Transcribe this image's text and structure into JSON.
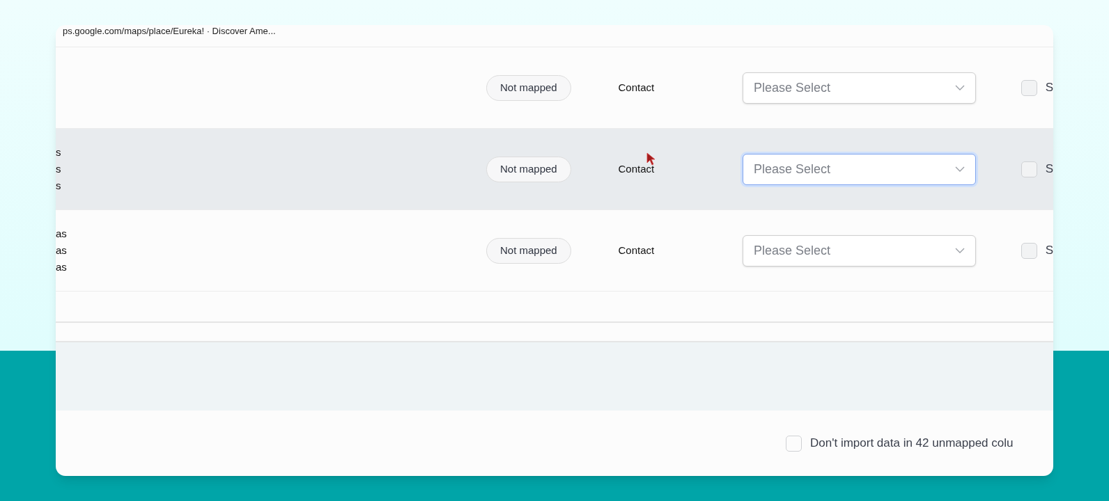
{
  "header_text": "ps.google.com/maps/place/Eureka! · Discover Ame...",
  "rows": [
    {
      "column_1": [],
      "status": "Not mapped",
      "object": "Contact",
      "select": {
        "placeholder": "Please Select",
        "focused": false
      },
      "checkbox": {
        "label": "S",
        "checked": false
      },
      "highlighted": false
    },
    {
      "column_1": [
        "s",
        "s",
        "s"
      ],
      "status": "Not mapped",
      "object": "Contact",
      "select": {
        "placeholder": "Please Select",
        "focused": true
      },
      "checkbox": {
        "label": "S",
        "checked": false
      },
      "highlighted": true
    },
    {
      "column_1": [
        "as",
        "as",
        "as"
      ],
      "status": "Not mapped",
      "object": "Contact",
      "select": {
        "placeholder": "Please Select",
        "focused": false
      },
      "checkbox": {
        "label": "S",
        "checked": false
      },
      "highlighted": false
    }
  ],
  "footer": {
    "label": "Don't import data in 42 unmapped colu",
    "checked": false
  }
}
